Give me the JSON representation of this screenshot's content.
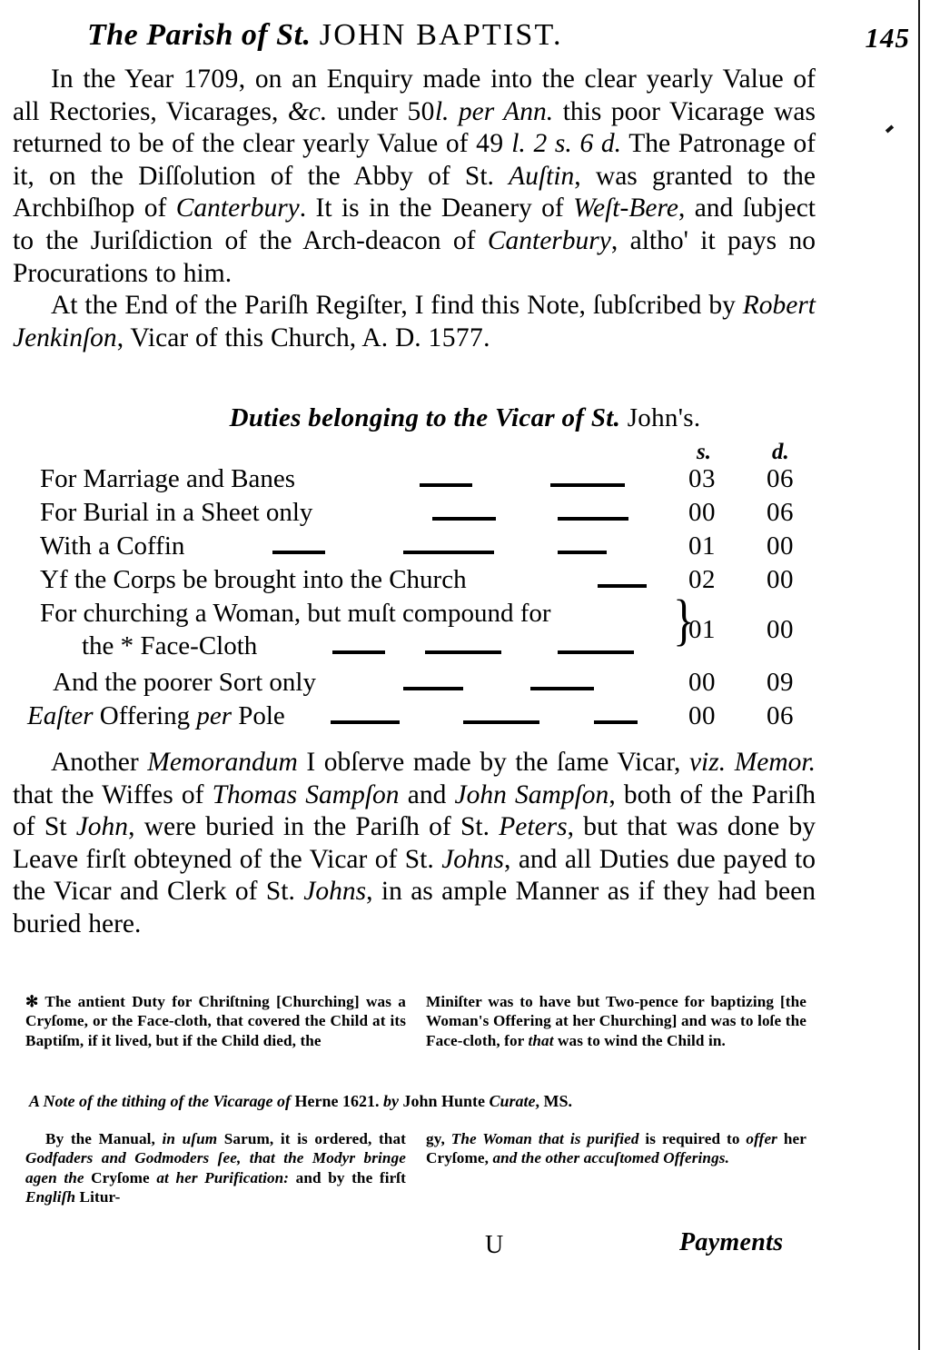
{
  "header": {
    "title_italic": "The Parish of St.",
    "title_caps": "JOHN BAPTIST.",
    "folio": "145"
  },
  "paragraphs": {
    "p1_part1": "In the Year ",
    "p1_year": "1709",
    "p1_part2": ", on an Enquiry made into the clear yearly Value of all Rectories, Vicarages, ",
    "p1_etc": "&c.",
    "p1_part3": " under ",
    "p1_fifty": "50",
    "p1_l1": "l. per Ann.",
    "p1_part4": " this poor Vicarage was returned to be of the clear yearly Value of ",
    "p1_49": "49",
    "p1_l2": "l.",
    "p1_2s": "2 s.",
    "p1_6d": "6 d.",
    "p1_part5": " The Patronage of it, on the Diſſolution of the Abby of St. ",
    "p1_austin": "Auſtin",
    "p1_part6": ", was granted to the Archbiſhop of ",
    "p1_canterbury": "Canterbury",
    "p1_part7": ". It is in the Deanery of ",
    "p1_westbere": "Weſt-Bere",
    "p1_part8": ", and ſubject to the Juriſdiction of the Arch-deacon of ",
    "p1_canterbury2": "Canterbury",
    "p1_part9": ", altho' it pays no Procurations to him.",
    "p2_part1": "At the End of the Pariſh Regiſter, I find this Note, ſubſcribed by ",
    "p2_jenkinson": "Robert Jenkinſon",
    "p2_part2": ", Vicar of this Church, A. D. ",
    "p2_year": "1577",
    "p2_part3": "."
  },
  "duties": {
    "heading_italic": "Duties belonging to the Vicar of St.",
    "heading_roman": " John's.",
    "col_s": "s.",
    "col_d": "d.",
    "rows": [
      {
        "label": "For Marriage and Banes",
        "s": "03",
        "d": "06"
      },
      {
        "label": "For Burial in a Sheet only",
        "s": "00",
        "d": "06"
      },
      {
        "label": "With a Coffin",
        "s": "01",
        "d": "00"
      },
      {
        "label": "Yf the Corps be brought into the Church",
        "s": "02",
        "d": "00"
      }
    ],
    "churching": {
      "line1": "For churching a Woman, but muſt compound for",
      "line2_pre": "the * ",
      "line2_rest": "Face-Cloth",
      "brace": "}",
      "s": "01",
      "d": "00"
    },
    "rows2": [
      {
        "label": "And the poorer Sort only",
        "s": "00",
        "d": "09"
      }
    ],
    "easter": {
      "label_italic": "Eaſter",
      "label_rest": " Offering ",
      "label_per": "per",
      "label_tail": " Pole",
      "s": "00",
      "d": "06"
    }
  },
  "memorandum": {
    "part1": "Another ",
    "memorandum_word": "Memorandum",
    "part2": " I obſerve made by the ſame Vicar, ",
    "viz": "viz. Memor.",
    "part3": " that the Wiffes of ",
    "thomas": "Thomas Sampſon",
    "part4": " and ",
    "john": "John Sampſon",
    "part5": ", both of the Pariſh of  St ",
    "stjohn": "John",
    "part6": ", were buried in the Pariſh of St. ",
    "peters": "Peters",
    "part7": ", but that was done by Leave firſt obteyned of the Vicar of St. ",
    "johns1": "Johns",
    "part8": ", and all Duties due payed to the Vicar and Clerk of St. ",
    "johns2": "Johns",
    "part9": ", in as ample Manner as if they had been buried here."
  },
  "footnote1": {
    "star": "✻",
    "left_pre": " The antient Duty for Chriſtning [Churching] was a Cryſome, or the Face-cloth, that covered the Child at its Baptiſm, if it lived, but if the Child died, the",
    "right": "Miniſter was to have but Two-pence for baptizing [the Woman's Offering at her Churching] and was to loſe the Face-cloth, for ",
    "right_italic": "that",
    "right_tail": " was to wind the Child in."
  },
  "note_line": {
    "italic1": "A Note of the tithing of  the Vicarage of",
    "roman1": " Herne 1621. ",
    "italic2": "by",
    "roman2": " John Hunte ",
    "italic3": "Curate",
    "roman3": ", MS."
  },
  "footnote2": {
    "left_p1": "By the Manual, ",
    "left_i1": "in uſum",
    "left_p2": " Sarum, it is ordered, that ",
    "left_i2": "Godfaders and Godmoders ſee, that the Modyr bringe agen the",
    "left_p3": " Cryſome ",
    "left_i3": "at her Purification:",
    "left_p4": " and by the firſt ",
    "left_i4": "Engliſh",
    "left_p5": " Litur-",
    "right_p1": "gy, ",
    "right_i1": "The Woman that is purified",
    "right_p2": " is required to ",
    "right_i2": "offer",
    "right_p3": " her Cryſome, ",
    "right_i3": "and the other accuſtomed Offerings.",
    "right_p4": ""
  },
  "footer": {
    "signature": "U",
    "catchword": "Payments"
  }
}
